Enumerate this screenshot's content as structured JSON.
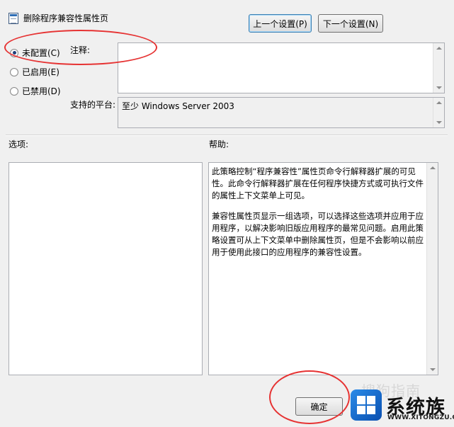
{
  "window": {
    "title": "删除程序兼容性属性页",
    "icon": "policy-icon"
  },
  "nav": {
    "prev_label": "上一个设置(P)",
    "next_label": "下一个设置(N)"
  },
  "state": {
    "options": [
      {
        "label": "未配置(C)",
        "checked": true
      },
      {
        "label": "已启用(E)",
        "checked": false
      },
      {
        "label": "已禁用(D)",
        "checked": false
      }
    ]
  },
  "comment": {
    "label": "注释:",
    "value": ""
  },
  "platform": {
    "label": "支持的平台:",
    "value": "至少 Windows Server 2003"
  },
  "options_section": {
    "label": "选项:"
  },
  "help_section": {
    "label": "帮助:",
    "paragraphs": [
      "此策略控制“程序兼容性”属性页命令行解释器扩展的可见性。此命令行解释器扩展在任何程序快捷方式或可执行文件的属性上下文菜单上可见。",
      "兼容性属性页显示一组选项，可以选择这些选项并应用于应用程序，以解决影响旧版应用程序的最常见问题。启用此策略设置可从上下文菜单中删除属性页，但是不会影响以前应用于使用此接口的应用程序的兼容性设置。"
    ]
  },
  "footer": {
    "ok_label": "确定"
  },
  "watermark": {
    "ghost_text": "搜狗指南",
    "brand": "系统族",
    "url": "WWW.XITONGZU.COM"
  },
  "colors": {
    "annotation": "#e63333",
    "accent": "#3c7fb1"
  }
}
